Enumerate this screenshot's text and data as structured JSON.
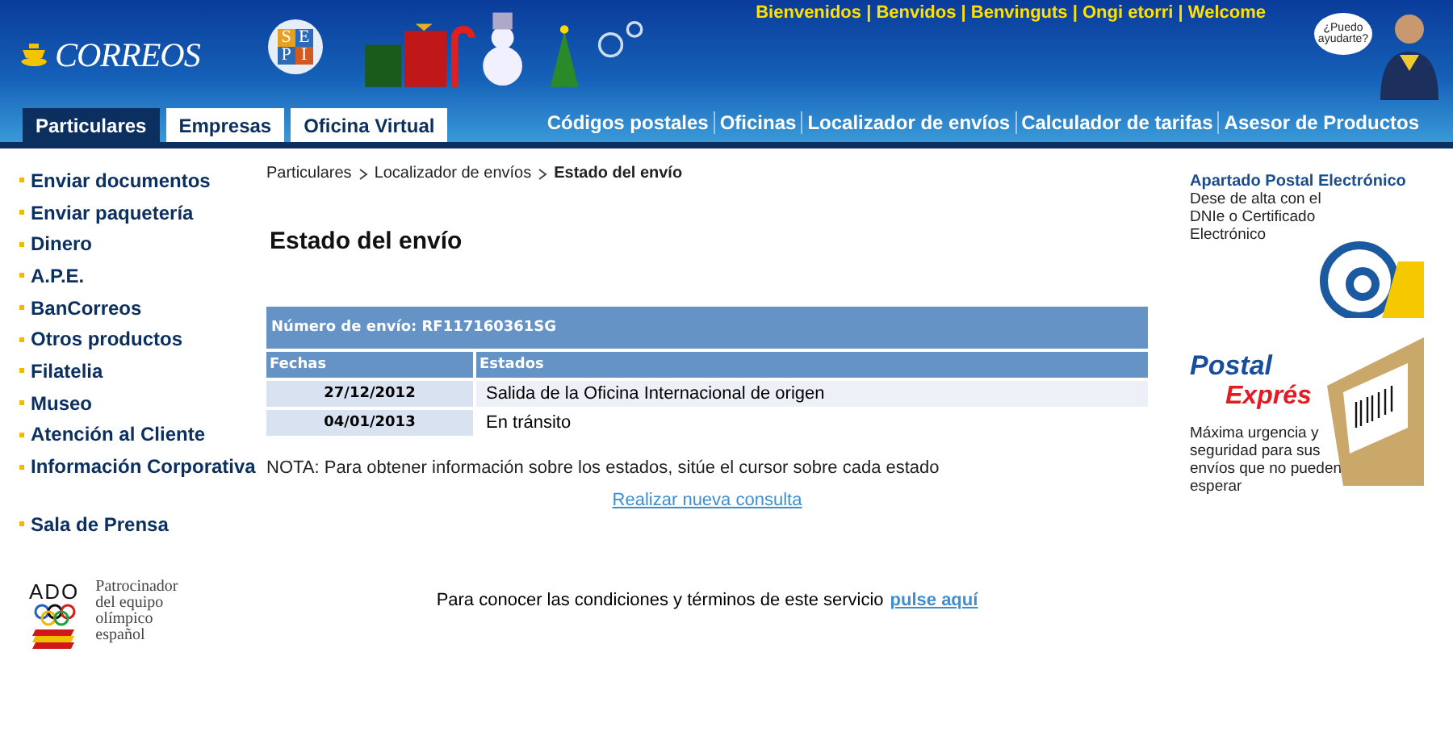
{
  "header": {
    "logo": "CORREOS",
    "sepi_letters": [
      "S",
      "E",
      "P",
      "I"
    ],
    "welcome": "Bienvenidos | Benvidos | Benvinguts | Ongi etorri | Welcome",
    "help_bubble": "¿Puedo ayudarte?",
    "tabs": [
      {
        "label": "Particulares",
        "selected": true
      },
      {
        "label": "Empresas",
        "selected": false
      },
      {
        "label": "Oficina Virtual",
        "selected": false
      }
    ],
    "links": [
      "Códigos postales",
      "Oficinas",
      "Localizador de envíos",
      "Calculador de tarifas",
      "Asesor de Productos"
    ]
  },
  "sidebar": {
    "items": [
      "Enviar documentos",
      "Enviar paquetería",
      "Dinero",
      "A.P.E.",
      "BanCorreos",
      "Otros productos",
      "Filatelia",
      "Museo",
      "Atención al Cliente",
      "Información Corporativa"
    ],
    "extra_items": [
      "Sala de Prensa"
    ],
    "sponsor": {
      "logo": "ADO",
      "text": "Patrocinador del equipo olímpico español"
    }
  },
  "breadcrumb": [
    {
      "label": "Particulares",
      "current": false
    },
    {
      "label": "Localizador de envíos",
      "current": false
    },
    {
      "label": "Estado del envío",
      "current": true
    }
  ],
  "title": "Estado del envío",
  "table": {
    "caption": "Número de envío: RF117160361SG",
    "columns": [
      "Fechas",
      "Estados"
    ],
    "rows": [
      [
        "27/12/2012",
        "Salida de la Oficina Internacional de origen"
      ],
      [
        "04/01/2013",
        "En tránsito"
      ]
    ]
  },
  "note": "NOTA: Para obtener información sobre los estados, sitúe el cursor sobre cada estado",
  "new_query_link": "Realizar nueva consulta",
  "terms": {
    "text": "Para conocer las condiciones y términos de este servicio",
    "link": "pulse aquí"
  },
  "ads": [
    {
      "kind": "email",
      "title": "Apartado Postal Electrónico",
      "body": "Dese de alta con el DNIe o Certificado Electrónico"
    },
    {
      "kind": "parcel",
      "title": "Postal",
      "subtitle": "Exprés",
      "body": "Máxima urgencia y seguridad para sus envíos que no pueden esperar"
    }
  ]
}
